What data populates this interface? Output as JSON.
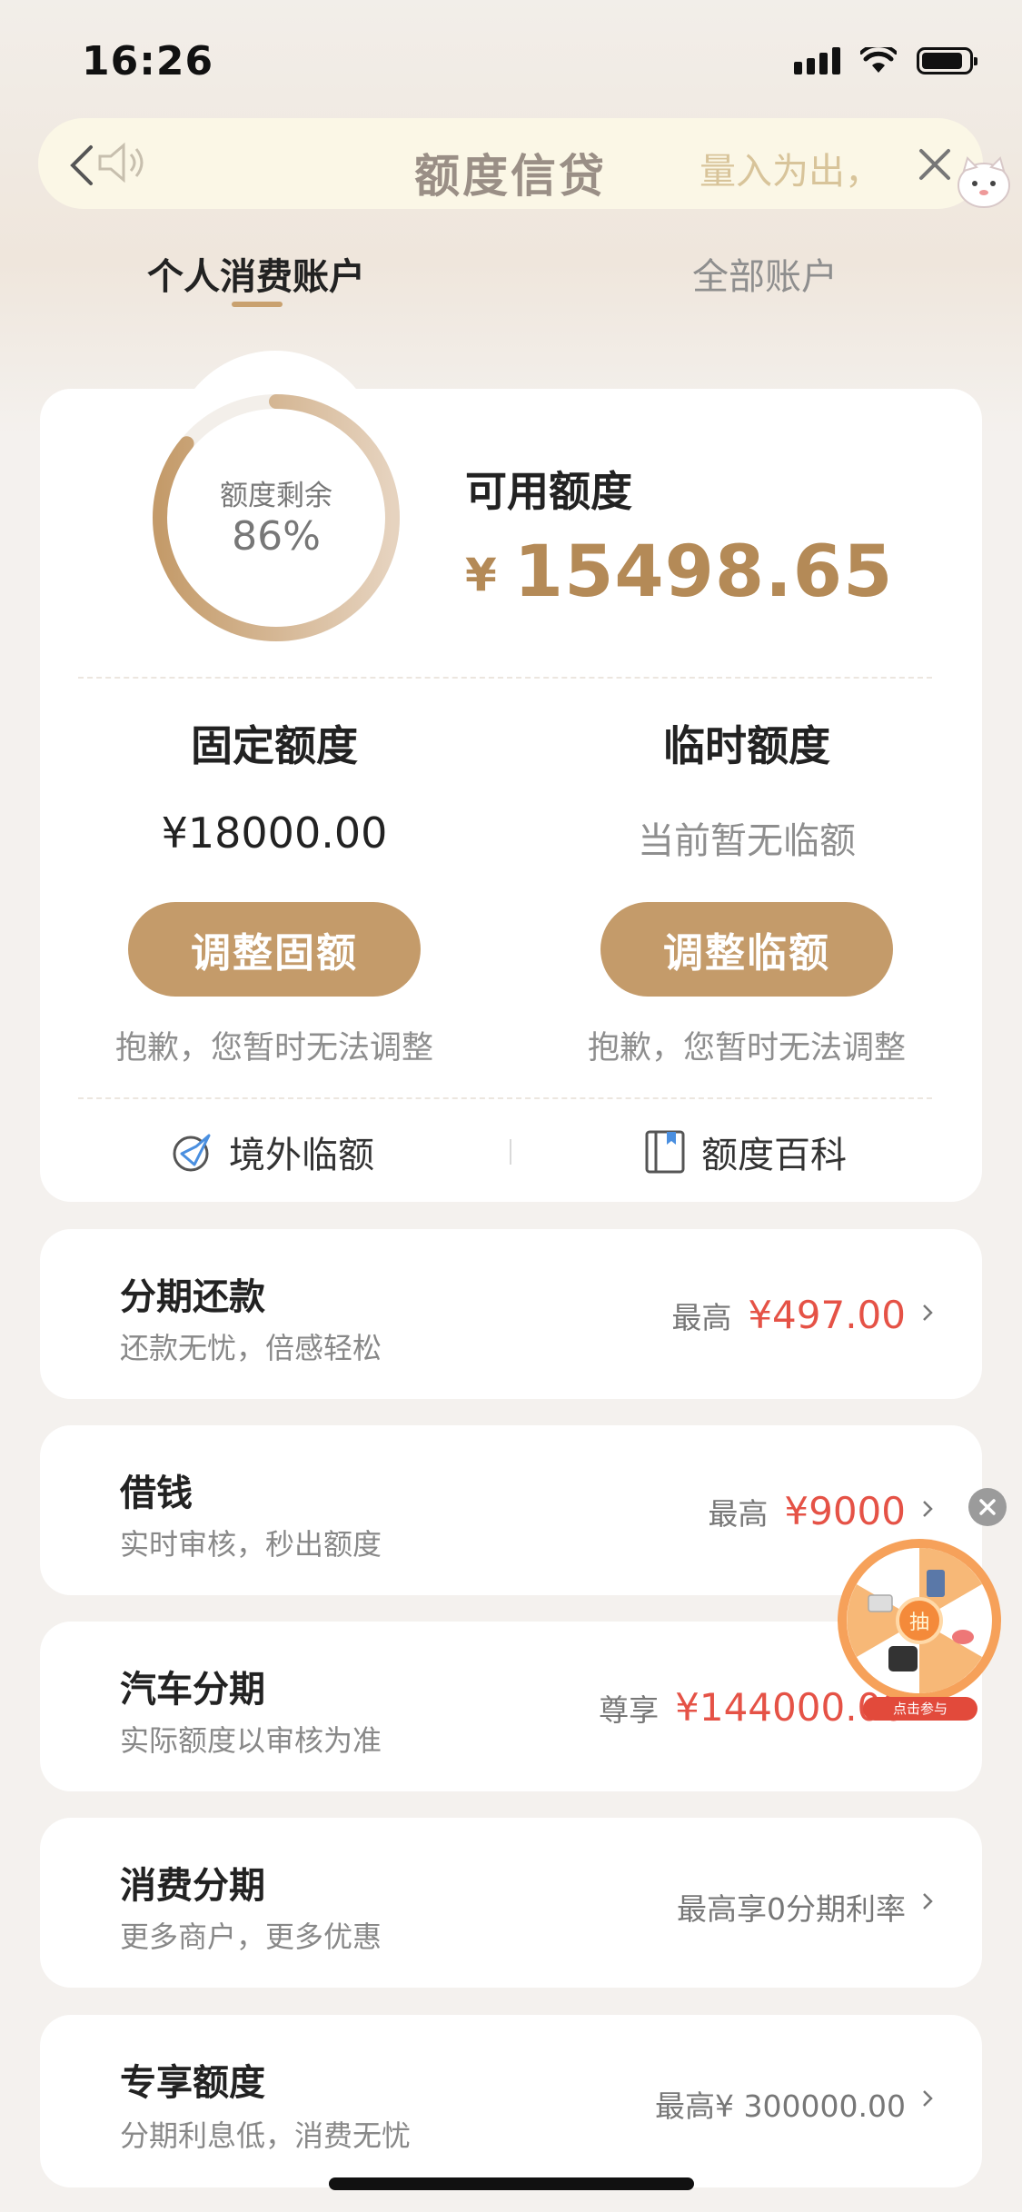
{
  "status_bar": {
    "time": "16:26"
  },
  "nav": {
    "title": "额度信贷",
    "marquee": "量入为出，",
    "icons": [
      "back-icon",
      "speaker-icon",
      "close-icon",
      "mascot-icon"
    ]
  },
  "tabs": [
    {
      "label": "个人消费账户",
      "active": true
    },
    {
      "label": "全部账户",
      "active": false
    }
  ],
  "quota": {
    "ring_label": "额度剩余",
    "ring_value": "86%",
    "ring_fraction": 0.86,
    "available_label": "可用额度",
    "currency": "¥",
    "available_amount": "15498.65",
    "fixed": {
      "title": "固定额度",
      "value": "¥18000.00",
      "button": "调整固额",
      "note": "抱歉，您暂时无法调整"
    },
    "temp": {
      "title": "临时额度",
      "value": "当前暂无临额",
      "button": "调整临额",
      "note": "抱歉，您暂时无法调整"
    },
    "links": [
      {
        "label": "境外临额",
        "icon": "plane-globe-icon"
      },
      {
        "label": "额度百科",
        "icon": "book-icon"
      }
    ]
  },
  "list": [
    {
      "title": "分期还款",
      "subtitle": "还款无忧，倍感轻松",
      "prefix": "最高",
      "amount": "¥497.00"
    },
    {
      "title": "借钱",
      "subtitle": "实时审核，秒出额度",
      "prefix": "最高",
      "amount": "¥9000"
    },
    {
      "title": "汽车分期",
      "subtitle": "实际额度以审核为准",
      "prefix": "尊享",
      "amount": "¥144000.00"
    },
    {
      "title": "消费分期",
      "subtitle": "更多商户，更多优惠",
      "plain": "最高享0分期利率"
    },
    {
      "title": "专享额度",
      "subtitle": "分期利息低，消费无忧",
      "plain": "最高¥ 300000.00"
    }
  ],
  "float_widget": {
    "center": "抽",
    "caption": "点击参与"
  },
  "colors": {
    "accent": "#c49b6a",
    "amount_gold": "#b48a57",
    "amount_red": "#e55246"
  }
}
